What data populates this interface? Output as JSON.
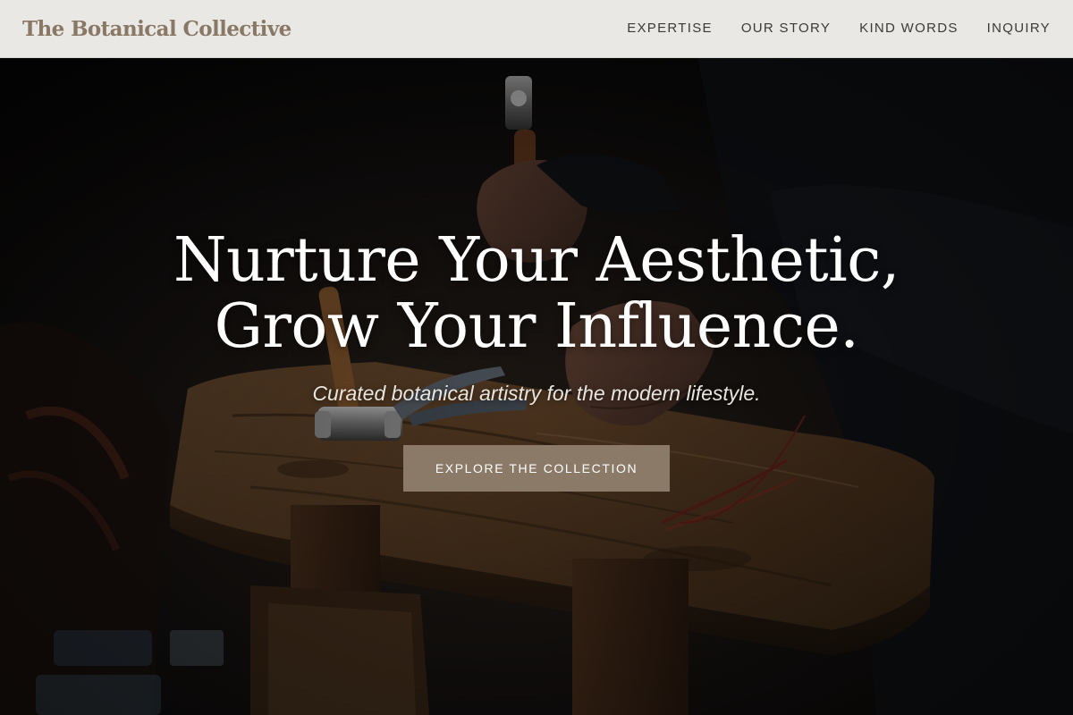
{
  "header": {
    "brand": "The Botanical Collective",
    "nav": [
      {
        "label": "EXPERTISE"
      },
      {
        "label": "OUR STORY"
      },
      {
        "label": "KIND WORDS"
      },
      {
        "label": "INQUIRY"
      }
    ]
  },
  "hero": {
    "title_line_1": "Nurture Your Aesthetic,",
    "title_line_2": "Grow Your Influence.",
    "subtitle": "Curated botanical artistry for the modern lifestyle.",
    "cta_label": "EXPLORE THE COLLECTION",
    "background_image": "craftsman-hammering-on-wooden-workbench-photo"
  },
  "colors": {
    "header_bg": "#e9e8e4",
    "brand": "#8a7866",
    "nav_text": "#3a3a3a",
    "cta_bg": "#8b7a68",
    "hero_text": "#ffffff"
  }
}
